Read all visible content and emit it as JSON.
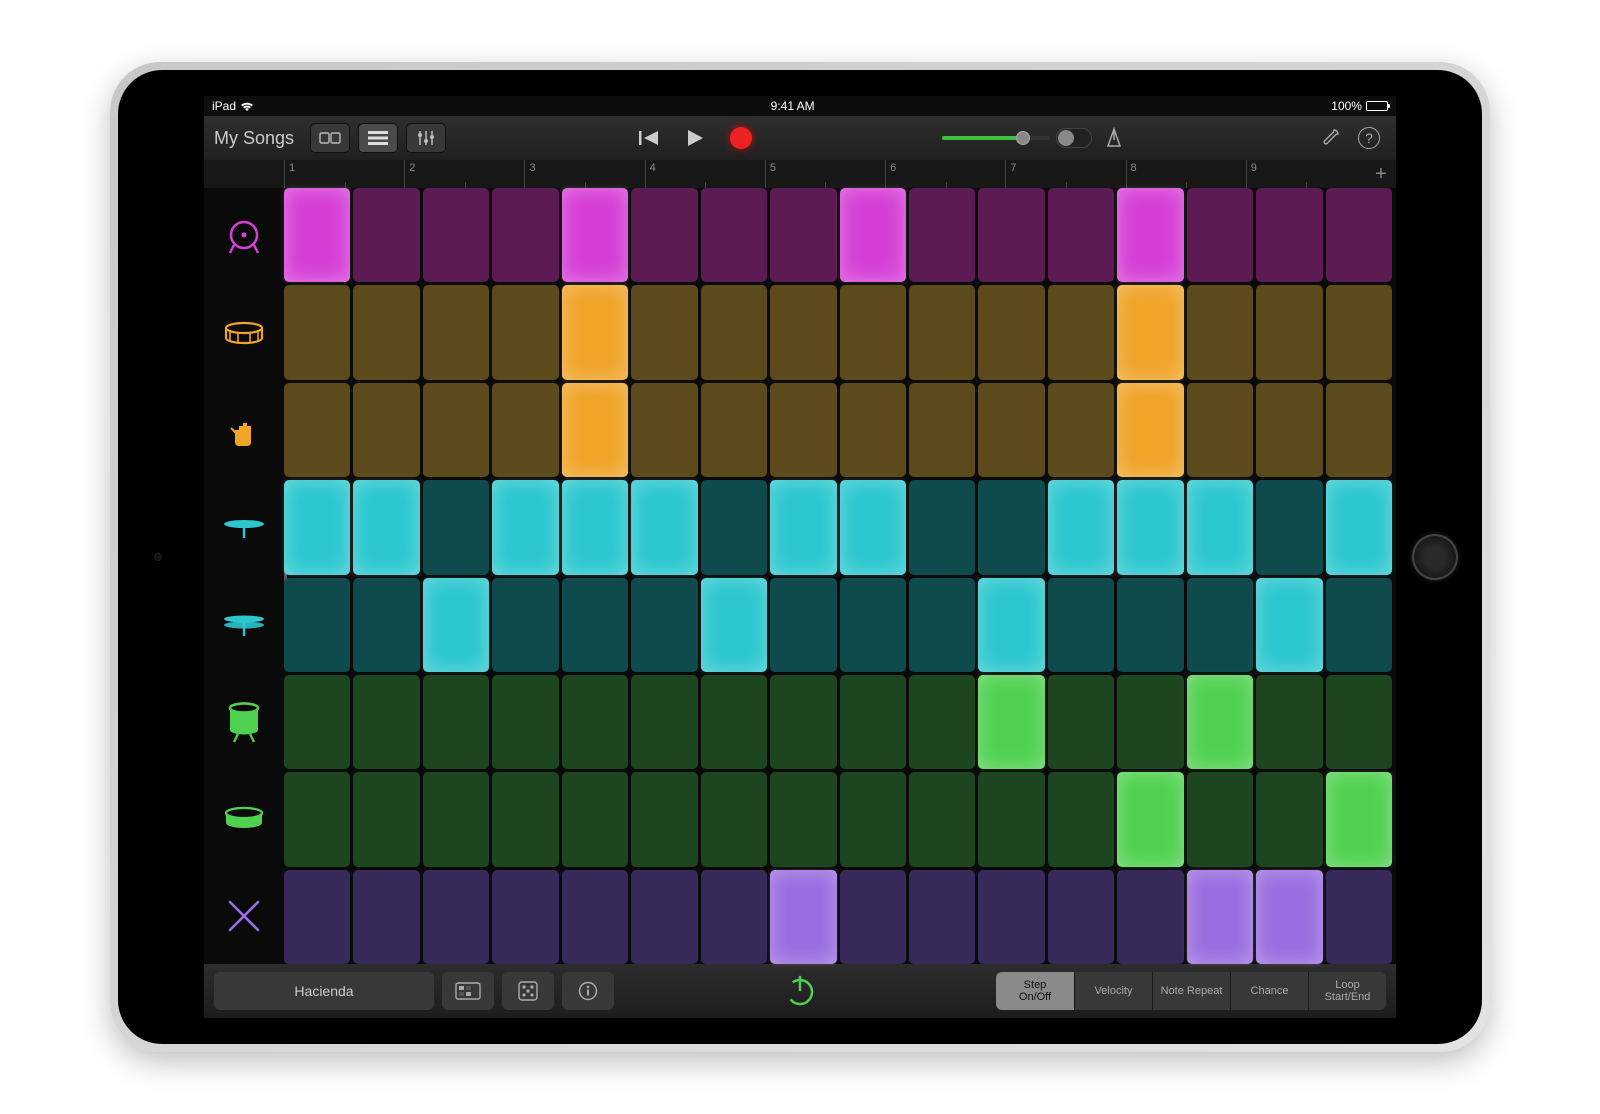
{
  "status": {
    "device_label": "iPad",
    "time": "9:41 AM",
    "battery_text": "100%"
  },
  "toolbar": {
    "my_songs_label": "My Songs"
  },
  "ruler": {
    "bars": [
      "1",
      "2",
      "3",
      "4",
      "5",
      "6",
      "7",
      "8",
      "9"
    ]
  },
  "bottom": {
    "kit_name": "Hacienda",
    "modes": [
      "Step\nOn/Off",
      "Velocity",
      "Note Repeat",
      "Chance",
      "Loop\nStart/End"
    ],
    "active_mode_index": 0
  },
  "instruments": [
    {
      "name": "kick",
      "color": "#d63fd6"
    },
    {
      "name": "snare",
      "color": "#f0a428"
    },
    {
      "name": "clap",
      "color": "#f0a428"
    },
    {
      "name": "closed-hat",
      "color": "#2cc7cf"
    },
    {
      "name": "open-hat",
      "color": "#2cc7cf"
    },
    {
      "name": "tom",
      "color": "#4fd14f"
    },
    {
      "name": "snare2",
      "color": "#4fd14f"
    },
    {
      "name": "sticks",
      "color": "#9a6de0"
    }
  ],
  "sequencer": {
    "steps": 16,
    "rows": [
      {
        "inst": "kick",
        "on": [
          0,
          4,
          8,
          12
        ],
        "off_color": "#5c1b53",
        "on_color": "#d63fd6"
      },
      {
        "inst": "snare",
        "on": [
          4,
          12
        ],
        "off_color": "#5c4a1d",
        "on_color": "#f0a428"
      },
      {
        "inst": "clap",
        "on": [
          4,
          12
        ],
        "off_color": "#5c4a1d",
        "on_color": "#f0a428"
      },
      {
        "inst": "closed-hat",
        "on": [
          0,
          1,
          3,
          4,
          5,
          7,
          8,
          11,
          12,
          13,
          15
        ],
        "off_color": "#0f4a4c",
        "on_color": "#2cc7cf"
      },
      {
        "inst": "open-hat",
        "on": [
          2,
          6,
          10,
          14
        ],
        "off_color": "#0f4a4c",
        "on_color": "#2cc7cf"
      },
      {
        "inst": "tom",
        "on": [
          10,
          13
        ],
        "off_color": "#1d4520",
        "on_color": "#4fd14f"
      },
      {
        "inst": "snare2",
        "on": [
          12,
          15
        ],
        "off_color": "#1d4520",
        "on_color": "#4fd14f"
      },
      {
        "inst": "sticks",
        "on": [
          7,
          13,
          14
        ],
        "off_color": "#37295a",
        "on_color": "#9a6de0"
      }
    ]
  }
}
